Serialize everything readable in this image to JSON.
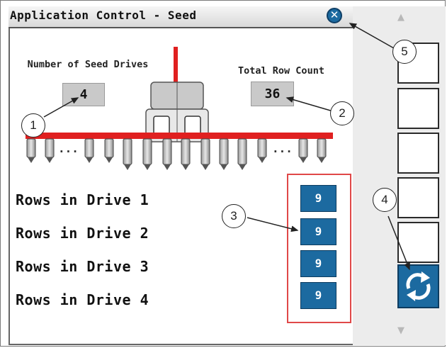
{
  "window": {
    "title": "Application Control - Seed",
    "close_glyph": "✕"
  },
  "seed_drives": {
    "label": "Number of Seed Drives",
    "value": "4"
  },
  "row_count": {
    "label": "Total Row Count",
    "value": "36"
  },
  "planter_ellipsis": "...",
  "drive_rows": [
    {
      "label": "Rows in Drive 1",
      "value": "9"
    },
    {
      "label": "Rows in Drive 2",
      "value": "9"
    },
    {
      "label": "Rows in Drive 3",
      "value": "9"
    },
    {
      "label": "Rows in Drive 4",
      "value": "9"
    }
  ],
  "sidebar": {
    "up_arrow": "▲",
    "down_arrow": "▼"
  },
  "callouts": [
    "1",
    "2",
    "3",
    "4",
    "5"
  ],
  "icons": {
    "close": "close-icon",
    "refresh": "refresh-icon",
    "planter": "planter-illustration"
  },
  "colors": {
    "accent_blue": "#1c6aa0",
    "planter_red": "#e02020",
    "callout_box": "#e04848"
  }
}
